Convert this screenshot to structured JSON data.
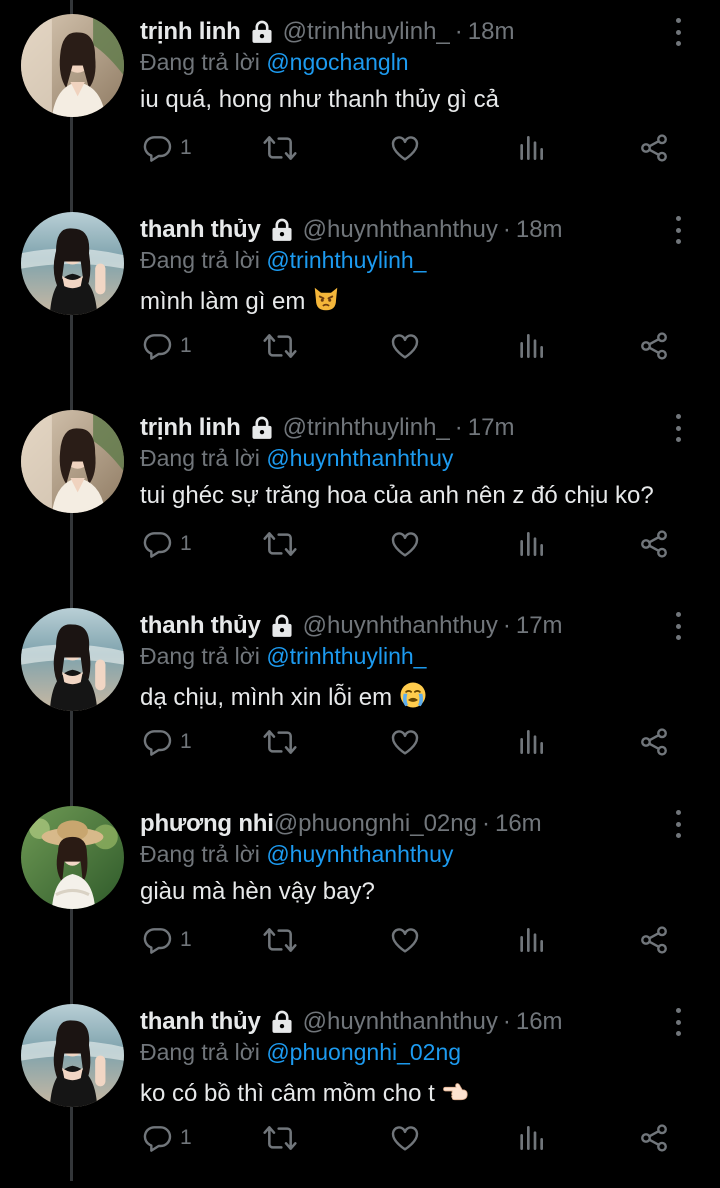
{
  "colors": {
    "background": "#000000",
    "text": "#e7e9ea",
    "muted": "#71767b",
    "link": "#1d9bf0",
    "thread_line": "#333639"
  },
  "tweets": [
    {
      "name": "trịnh linh",
      "locked": true,
      "handle": "@trinhthuylinh_",
      "sep": "·",
      "time": "18m",
      "reply_prefix": "Đang trả lời ",
      "reply_to": "@ngochangln",
      "text": "iu quá, hong như thanh thủy gì cả",
      "emoji": "",
      "reply_count": "1",
      "avatar_icon": "avatar-linh"
    },
    {
      "name": "thanh thủy",
      "locked": true,
      "handle": "@huynhthanhthuy",
      "sep": "·",
      "time": "18m",
      "reply_prefix": "Đang trả lời ",
      "reply_to": "@trinhthuylinh_",
      "text": "mình làm gì em",
      "emoji": "pouting-cat-emoji",
      "reply_count": "1",
      "avatar_icon": "avatar-thuy"
    },
    {
      "name": "trịnh linh",
      "locked": true,
      "handle": "@trinhthuylinh_",
      "sep": "·",
      "time": "17m",
      "reply_prefix": "Đang trả lời ",
      "reply_to": "@huynhthanhthuy",
      "text": "tui ghéc sự trăng hoa của anh nên z đó chịu ko?",
      "emoji": "",
      "reply_count": "1",
      "avatar_icon": "avatar-linh"
    },
    {
      "name": "thanh thủy",
      "locked": true,
      "handle": "@huynhthanhthuy",
      "sep": "·",
      "time": "17m",
      "reply_prefix": "Đang trả lời ",
      "reply_to": "@trinhthuylinh_",
      "text": "dạ chịu, mình xin lỗi em",
      "emoji": "crying-face-emoji",
      "reply_count": "1",
      "avatar_icon": "avatar-thuy"
    },
    {
      "name": "phương nhi",
      "locked": false,
      "handle": "@phuongnhi_02ng",
      "sep": "·",
      "time": "16m",
      "reply_prefix": "Đang trả lời ",
      "reply_to": "@huynhthanhthuy",
      "text": "giàu mà hèn vậy bay?",
      "emoji": "",
      "reply_count": "1",
      "avatar_icon": "avatar-nhi"
    },
    {
      "name": "thanh thủy",
      "locked": true,
      "handle": "@huynhthanhthuy",
      "sep": "·",
      "time": "16m",
      "reply_prefix": "Đang trả lời ",
      "reply_to": "@phuongnhi_02ng",
      "text": "ko có bồ thì câm mồm cho t",
      "emoji": "pointing-left-emoji",
      "reply_count": "1",
      "avatar_icon": "avatar-thuy"
    }
  ],
  "action_icons": [
    "reply-icon",
    "retweet-icon",
    "like-icon",
    "views-icon",
    "share-icon"
  ]
}
